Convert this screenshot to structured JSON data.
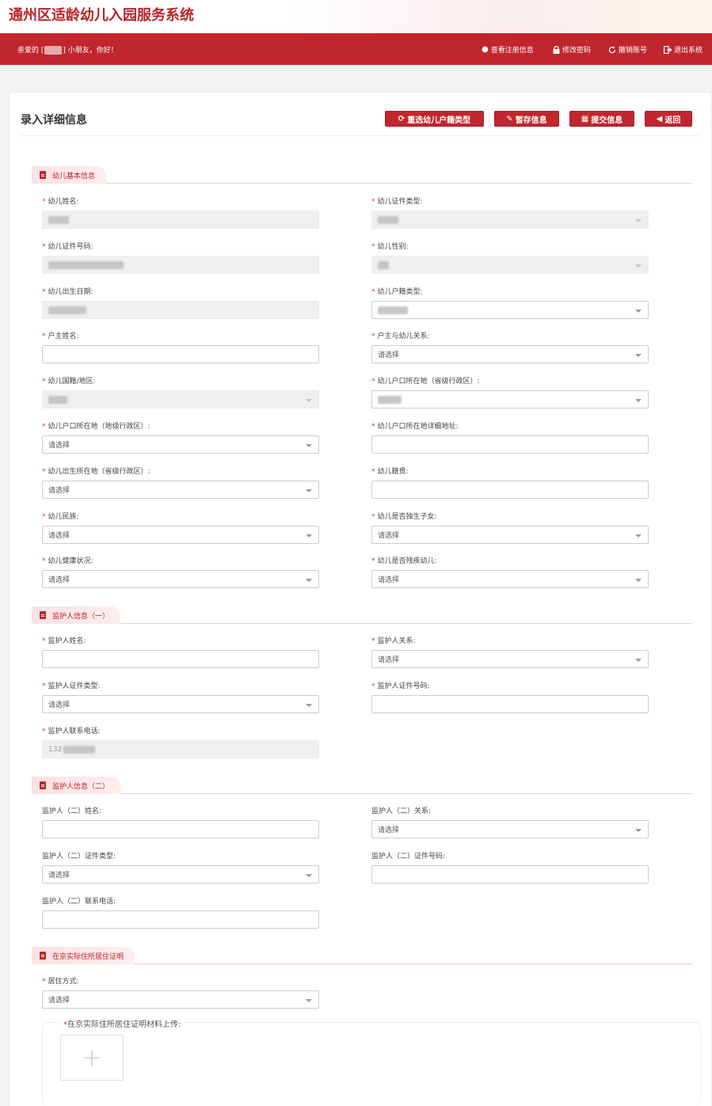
{
  "app": {
    "title": "通州区适龄幼儿入园服务系统"
  },
  "nav": {
    "greeting_prefix": "亲爱的",
    "greeting_suffix": "小朋友，你好！",
    "items": [
      {
        "label": "查看注册信息",
        "icon": "info-icon"
      },
      {
        "label": "修改密码",
        "icon": "lock-icon"
      },
      {
        "label": "撤销账号",
        "icon": "refresh-icon"
      },
      {
        "label": "退出系统",
        "icon": "logout-icon"
      }
    ]
  },
  "page": {
    "title": "录入详细信息",
    "buttons": {
      "reselect": "重选幼儿户籍类型",
      "save": "暂存信息",
      "submit": "提交信息",
      "back": "返回"
    }
  },
  "placeholder_select": "请选择",
  "sections": {
    "child": "幼儿基本信息",
    "guardian1": "监护人信息（一）",
    "guardian2": "监护人信息（二）",
    "residence": "在京实际住所居住证明"
  },
  "child_fields": {
    "name": "幼儿姓名:",
    "id_type": "幼儿证件类型:",
    "id_number": "幼儿证件号码:",
    "gender": "幼儿性别:",
    "birth_date": "幼儿出生日期:",
    "hukou_type": "幼儿户籍类型:",
    "householder_name": "户主姓名:",
    "householder_relation": "户主与幼儿关系:",
    "nationality": "幼儿国籍/地区:",
    "hukou_province": "幼儿户口所在地（省级行政区）:",
    "hukou_city": "幼儿户口所在地（地级行政区）:",
    "hukou_address": "幼儿户口所在地详细地址:",
    "birth_province": "幼儿出生所在地（省级行政区）:",
    "native_place": "幼儿籍贯:",
    "ethnicity": "幼儿民族:",
    "only_child": "幼儿是否独生子女:",
    "health": "幼儿健康状况:",
    "disabled_child": "幼儿是否残疾幼儿:"
  },
  "guardian1_fields": {
    "name": "监护人姓名:",
    "relation": "监护人关系:",
    "id_type": "监护人证件类型:",
    "id_number": "监护人证件号码:",
    "phone": "监护人联系电话:",
    "phone_value": "132"
  },
  "guardian2_fields": {
    "name": "监护人（二）姓名:",
    "relation": "监护人（二）关系:",
    "id_type": "监护人（二）证件类型:",
    "id_number": "监护人（二）证件号码:",
    "phone": "监护人（二）联系电话:"
  },
  "residence_fields": {
    "mode": "居住方式:",
    "upload_label": "在京实际住所居住证明材料上传:"
  }
}
